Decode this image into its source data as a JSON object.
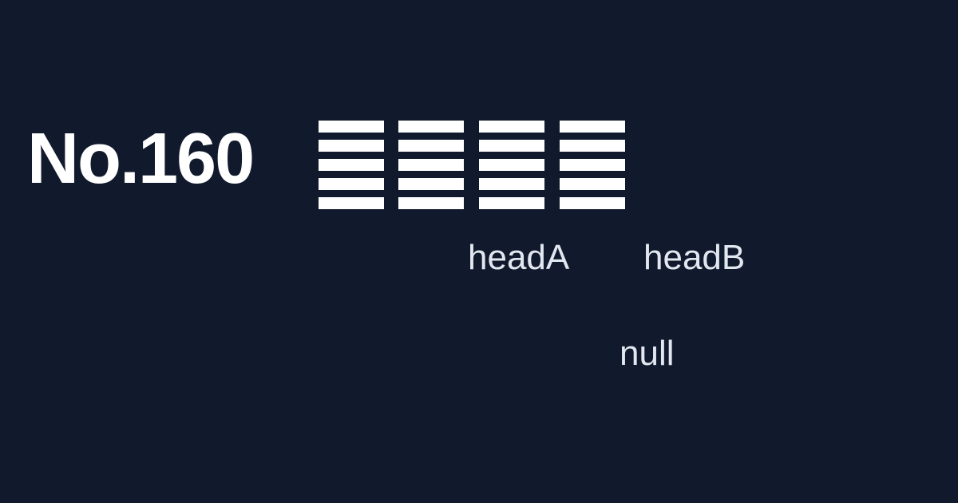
{
  "title": "No.160",
  "glyphs": [
    {
      "name": "glyph-1",
      "lines": 5
    },
    {
      "name": "glyph-2",
      "lines": 5
    },
    {
      "name": "glyph-3",
      "lines": 5
    },
    {
      "name": "glyph-4",
      "lines": 5
    }
  ],
  "labels": {
    "headA": "headA",
    "headB": "headB",
    "null": "null"
  },
  "colors": {
    "background": "#111a2d",
    "foreground": "#ffffff",
    "label": "#e2e7f0"
  }
}
